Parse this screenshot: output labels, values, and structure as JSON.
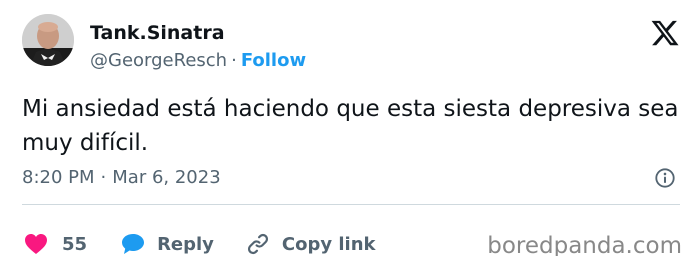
{
  "author": {
    "display_name": "Tank.Sinatra",
    "handle": "@GeorgeResch",
    "separator": "·",
    "follow_label": "Follow"
  },
  "tweet": {
    "text": "Mi ansiedad está haciendo que esta siesta depresiva sea muy difícil.",
    "time": "8:20 PM",
    "separator": "·",
    "date": "Mar 6, 2023"
  },
  "actions": {
    "like_count": "55",
    "reply_label": "Reply",
    "copy_link_label": "Copy link"
  },
  "watermark": "boredpanda.com",
  "icons": {
    "logo": "x-logo-icon",
    "info": "info-icon",
    "like": "heart-icon",
    "reply": "speech-bubble-icon",
    "copy": "link-icon"
  },
  "colors": {
    "accent": "#1d9bf0",
    "like": "#f91880",
    "text": "#0f1419",
    "secondary": "#536471",
    "divider": "#cfd9de"
  }
}
